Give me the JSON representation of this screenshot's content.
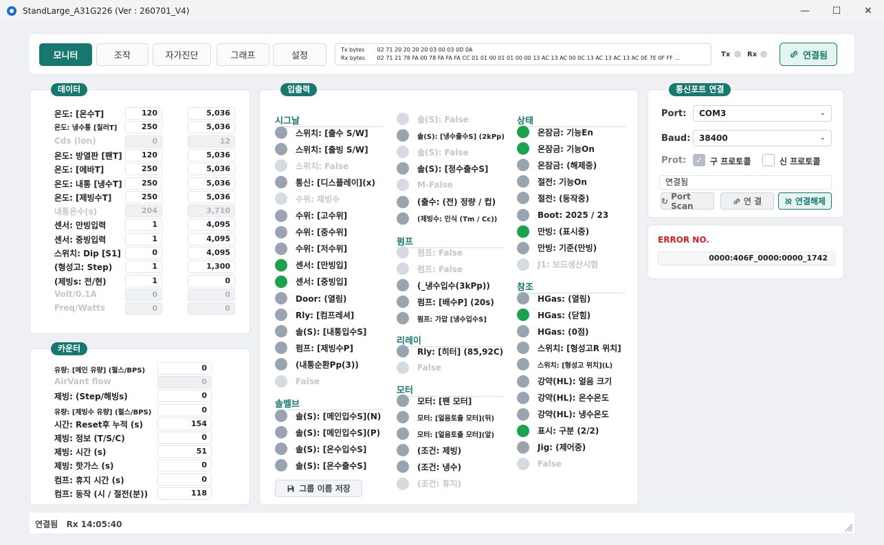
{
  "window": {
    "title": "StandLarge_A31G226 (Ver : 260701_V4)",
    "minimize": "—",
    "maximize": "☐",
    "close": "✕"
  },
  "tabs": [
    "모니터",
    "조작",
    "자가진단",
    "그래프",
    "설정"
  ],
  "txrx": {
    "tx_label": "Tx bytes",
    "tx_value": "02 71 20 20 20 20 03 00 03 0D 0A",
    "rx_label": "Rx bytes",
    "rx_value": "02 71 21 78 FA 00 78 FA FA FA CC 01 01 00 01 01 00 00 13 AC 13 AC 00 0C 13 AC 13 AC 13 AC 0E 7E 0F FF ..."
  },
  "leds": {
    "tx": "Tx",
    "rx": "Rx"
  },
  "connected_button": "연결됨",
  "data_panel": {
    "title": "데이터",
    "rows": [
      {
        "label": "온도: [온수T]",
        "v1": "120",
        "v2": "5,036",
        "disabled": false
      },
      {
        "label": "온도: 냉수통 [칠러T]",
        "v1": "250",
        "v2": "5,036",
        "disabled": false
      },
      {
        "label": "Cds         (lon)",
        "v1": "0",
        "v2": "12",
        "disabled": true
      },
      {
        "label": "온도: 방열판 [팬T]",
        "v1": "120",
        "v2": "5,036",
        "disabled": false
      },
      {
        "label": "온도: [에바T]",
        "v1": "250",
        "v2": "5,036",
        "disabled": false
      },
      {
        "label": "온도: 내통 [냉수T]",
        "v1": "250",
        "v2": "5,036",
        "disabled": false
      },
      {
        "label": "온도: [제빙수T]",
        "v1": "250",
        "v2": "5,036",
        "disabled": false
      },
      {
        "label": "내통온수(s)",
        "v1": "204",
        "v2": "3,710",
        "disabled": true
      },
      {
        "label": "센서: 만빙입력",
        "v1": "1",
        "v2": "4,095",
        "disabled": false
      },
      {
        "label": "센서: 중빙입력",
        "v1": "1",
        "v2": "4,095",
        "disabled": false
      },
      {
        "label": "스위치: Dip [S1]",
        "v1": "0",
        "v2": "4,095",
        "disabled": false
      },
      {
        "label": "(형성고: Step)",
        "v1": "1",
        "v2": "1,300",
        "disabled": false
      },
      {
        "label": "(제빙s: 전/현)",
        "v1": "1",
        "v2": "0",
        "disabled": false
      },
      {
        "label": "Volt/0.1A",
        "v1": "0",
        "v2": "0",
        "disabled": true
      },
      {
        "label": "Freq/Watts",
        "v1": "0",
        "v2": "0",
        "disabled": true
      }
    ]
  },
  "counter_panel": {
    "title": "카운터",
    "rows": [
      {
        "label": "유량: [메인 유량] (펄스/BPS)",
        "value": "0",
        "disabled": false,
        "small": true
      },
      {
        "label": "AirVant flow",
        "value": "0",
        "disabled": true,
        "small": false
      },
      {
        "label": "제빙: (Step/해빙s)",
        "value": "0",
        "disabled": false,
        "small": false
      },
      {
        "label": "유량: [제빙수 유량] (펄스/BPS)",
        "value": "0",
        "disabled": false,
        "small": true
      },
      {
        "label": "시간: Reset후 누적 (s)",
        "value": "154",
        "disabled": false,
        "small": false
      },
      {
        "label": "제빙: 정보 (T/S/C)",
        "value": "0",
        "disabled": false,
        "small": false
      },
      {
        "label": "제빙: 시간 (s)",
        "value": "51",
        "disabled": false,
        "small": false
      },
      {
        "label": "제빙: 핫가스 (s)",
        "value": "0",
        "disabled": false,
        "small": false
      },
      {
        "label": "컴프: 휴지 시간 (s)",
        "value": "0",
        "disabled": false,
        "small": false
      },
      {
        "label": "컴프: 동작 (시 / 절전(분))",
        "value": "118",
        "disabled": false,
        "small": false
      }
    ]
  },
  "io_panel": {
    "title": "입출력",
    "col1": {
      "signal_head": "시그날",
      "signal": [
        {
          "label": "스위치: [출수 S/W]",
          "state": "off"
        },
        {
          "label": "스위치: [출빙 S/W]",
          "state": "off"
        },
        {
          "label": "스위치: False",
          "state": "dis"
        },
        {
          "label": "통신: [디스플레이](x)",
          "state": "off"
        },
        {
          "label": "수위: 제빙수",
          "state": "dis"
        },
        {
          "label": "수위: [고수위]",
          "state": "off"
        },
        {
          "label": "수위: [중수위]",
          "state": "off"
        },
        {
          "label": "수위: [저수위]",
          "state": "off"
        },
        {
          "label": "센서: [만빙입]",
          "state": "on"
        },
        {
          "label": "센서: [중빙입]",
          "state": "on"
        },
        {
          "label": "Door: (열림)",
          "state": "off"
        },
        {
          "label": "Rly: [컴프레셔]",
          "state": "off"
        },
        {
          "label": "솔(S): [내통입수S]",
          "state": "off"
        },
        {
          "label": "펌프: [제빙수P]",
          "state": "off"
        },
        {
          "label": "(내통순환Pp(3))",
          "state": "off"
        },
        {
          "label": "False",
          "state": "dis"
        }
      ],
      "solv_head": "솔벨브",
      "solv": [
        {
          "label": "솔(S): [메인입수S](N)",
          "state": "off"
        },
        {
          "label": "솔(S): [메인입수S](P)",
          "state": "off"
        },
        {
          "label": "솔(S): [온수입수S]",
          "state": "off"
        },
        {
          "label": "솔(S): [온수출수S]",
          "state": "off"
        }
      ],
      "save_button": "그룹 이름 저장"
    },
    "col2": {
      "top": [
        {
          "label": "솔(S): False",
          "state": "dis",
          "small": false
        },
        {
          "label": "솔(S): [냉수출수S] (2kPp)",
          "state": "off",
          "small": true
        },
        {
          "label": "솔(S): False",
          "state": "dis",
          "small": false
        },
        {
          "label": "솔(S): [정수출수S]",
          "state": "off",
          "small": false
        },
        {
          "label": "M-False",
          "state": "dis",
          "small": false
        },
        {
          "label": "(출수: (전) 정량 / 컵)",
          "state": "off",
          "small": false
        },
        {
          "label": "(제빙수: 인식 (Tm / Cc))",
          "state": "off",
          "small": true
        }
      ],
      "pump_head": "펌프",
      "pump": [
        {
          "label": "펌프: False",
          "state": "dis",
          "small": false
        },
        {
          "label": "펌프: False",
          "state": "dis",
          "small": false
        },
        {
          "label": "(_냉수입수(3kPp))",
          "state": "off",
          "small": false
        },
        {
          "label": "펌프: [배수P] (20s)",
          "state": "off",
          "small": false
        },
        {
          "label": "펌프: 가압 [냉수입수S]",
          "state": "off",
          "small": true
        }
      ],
      "relay_head": "리레이",
      "relay": [
        {
          "label": "Rly: [히터] (85,92C)",
          "state": "off",
          "small": false
        },
        {
          "label": "False",
          "state": "dis",
          "small": false
        }
      ],
      "motor_head": "모터",
      "motor": [
        {
          "label": "모터: [팬 모터]",
          "state": "off",
          "small": false
        },
        {
          "label": "모터: [얼음토출 모터](뒤)",
          "state": "off",
          "small": true
        },
        {
          "label": "모터: [얼음토출 모터](앞)",
          "state": "off",
          "small": true
        },
        {
          "label": "(조건: 제빙)",
          "state": "off",
          "small": false
        },
        {
          "label": "(조건: 냉수)",
          "state": "off",
          "small": false
        },
        {
          "label": "(조건: 휴지)",
          "state": "dis",
          "small": false
        }
      ]
    },
    "col3": {
      "state_head": "상태",
      "state": [
        {
          "label": "온잠금: 기능En",
          "state": "on",
          "small": false
        },
        {
          "label": "온잠금: 기능On",
          "state": "on",
          "small": false
        },
        {
          "label": "온잠금: (해제중)",
          "state": "off",
          "small": false
        },
        {
          "label": "절전: 기능On",
          "state": "off",
          "small": false
        },
        {
          "label": "절전: (동작중)",
          "state": "off",
          "small": false
        },
        {
          "label": "Boot: 2025 / 23",
          "state": "off",
          "small": false
        },
        {
          "label": "만빙: (표시중)",
          "state": "on",
          "small": false
        },
        {
          "label": "만빙: 기준(만빙)",
          "state": "off",
          "small": false
        },
        {
          "label": "J1: 보드생산시험",
          "state": "dis",
          "small": false
        }
      ],
      "ref_head": "참조",
      "ref": [
        {
          "label": "HGas: (열림)",
          "state": "off",
          "small": false
        },
        {
          "label": "HGas: (닫힘)",
          "state": "on",
          "small": false
        },
        {
          "label": "HGas: (0점)",
          "state": "off",
          "small": false
        },
        {
          "label": "스위치: [형성고R 위치]",
          "state": "off",
          "small": false
        },
        {
          "label": "스위치: [형성고 위치](L)",
          "state": "off",
          "small": true
        },
        {
          "label": "강약(HL): 얼음 크기",
          "state": "off",
          "small": false
        },
        {
          "label": "강약(HL): 온수온도",
          "state": "off",
          "small": false
        },
        {
          "label": "강약(HL): 냉수온도",
          "state": "off",
          "small": false
        },
        {
          "label": "표시: 구분 (2/2)",
          "state": "on",
          "small": false
        },
        {
          "label": "Jig: (제어중)",
          "state": "off",
          "small": false
        },
        {
          "label": "False",
          "state": "dis",
          "small": false
        }
      ]
    }
  },
  "comport_panel": {
    "title": "통신포트 연결",
    "port_label": "Port:",
    "port_value": "COM3",
    "baud_label": "Baud:",
    "baud_value": "38400",
    "prot_label": "Prot:",
    "old_protocol": "구 프로토콜",
    "new_protocol": "신 프로토콜",
    "status": "연결됨",
    "port_scan": "Port Scan",
    "connect": "연 결",
    "disconnect": "연결해제"
  },
  "error_panel": {
    "title": "ERROR NO.",
    "value": "0000:406F_0000:0000_1742"
  },
  "statusbar": {
    "text": "연결됨   Rx 14:05:40"
  },
  "colors": {
    "accent": "#16786e",
    "led_on": "#1aa24c",
    "led_off": "#9aa4b0",
    "error": "#d02020"
  }
}
